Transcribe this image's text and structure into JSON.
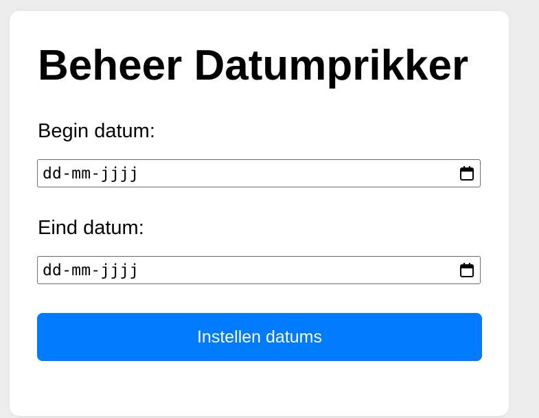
{
  "form": {
    "title": "Beheer Datumprikker",
    "begin": {
      "label": "Begin datum:",
      "placeholder": "dd-mm-jjjj",
      "icon": "calendar-icon"
    },
    "end": {
      "label": "Eind datum:",
      "placeholder": "dd-mm-jjjj",
      "icon": "calendar-icon"
    },
    "submit_label": "Instellen datums"
  },
  "colors": {
    "page_background": "#ececec",
    "card_background": "#ffffff",
    "accent": "#007bff",
    "button_text": "#ffffff",
    "input_border": "#6b6b6b"
  }
}
